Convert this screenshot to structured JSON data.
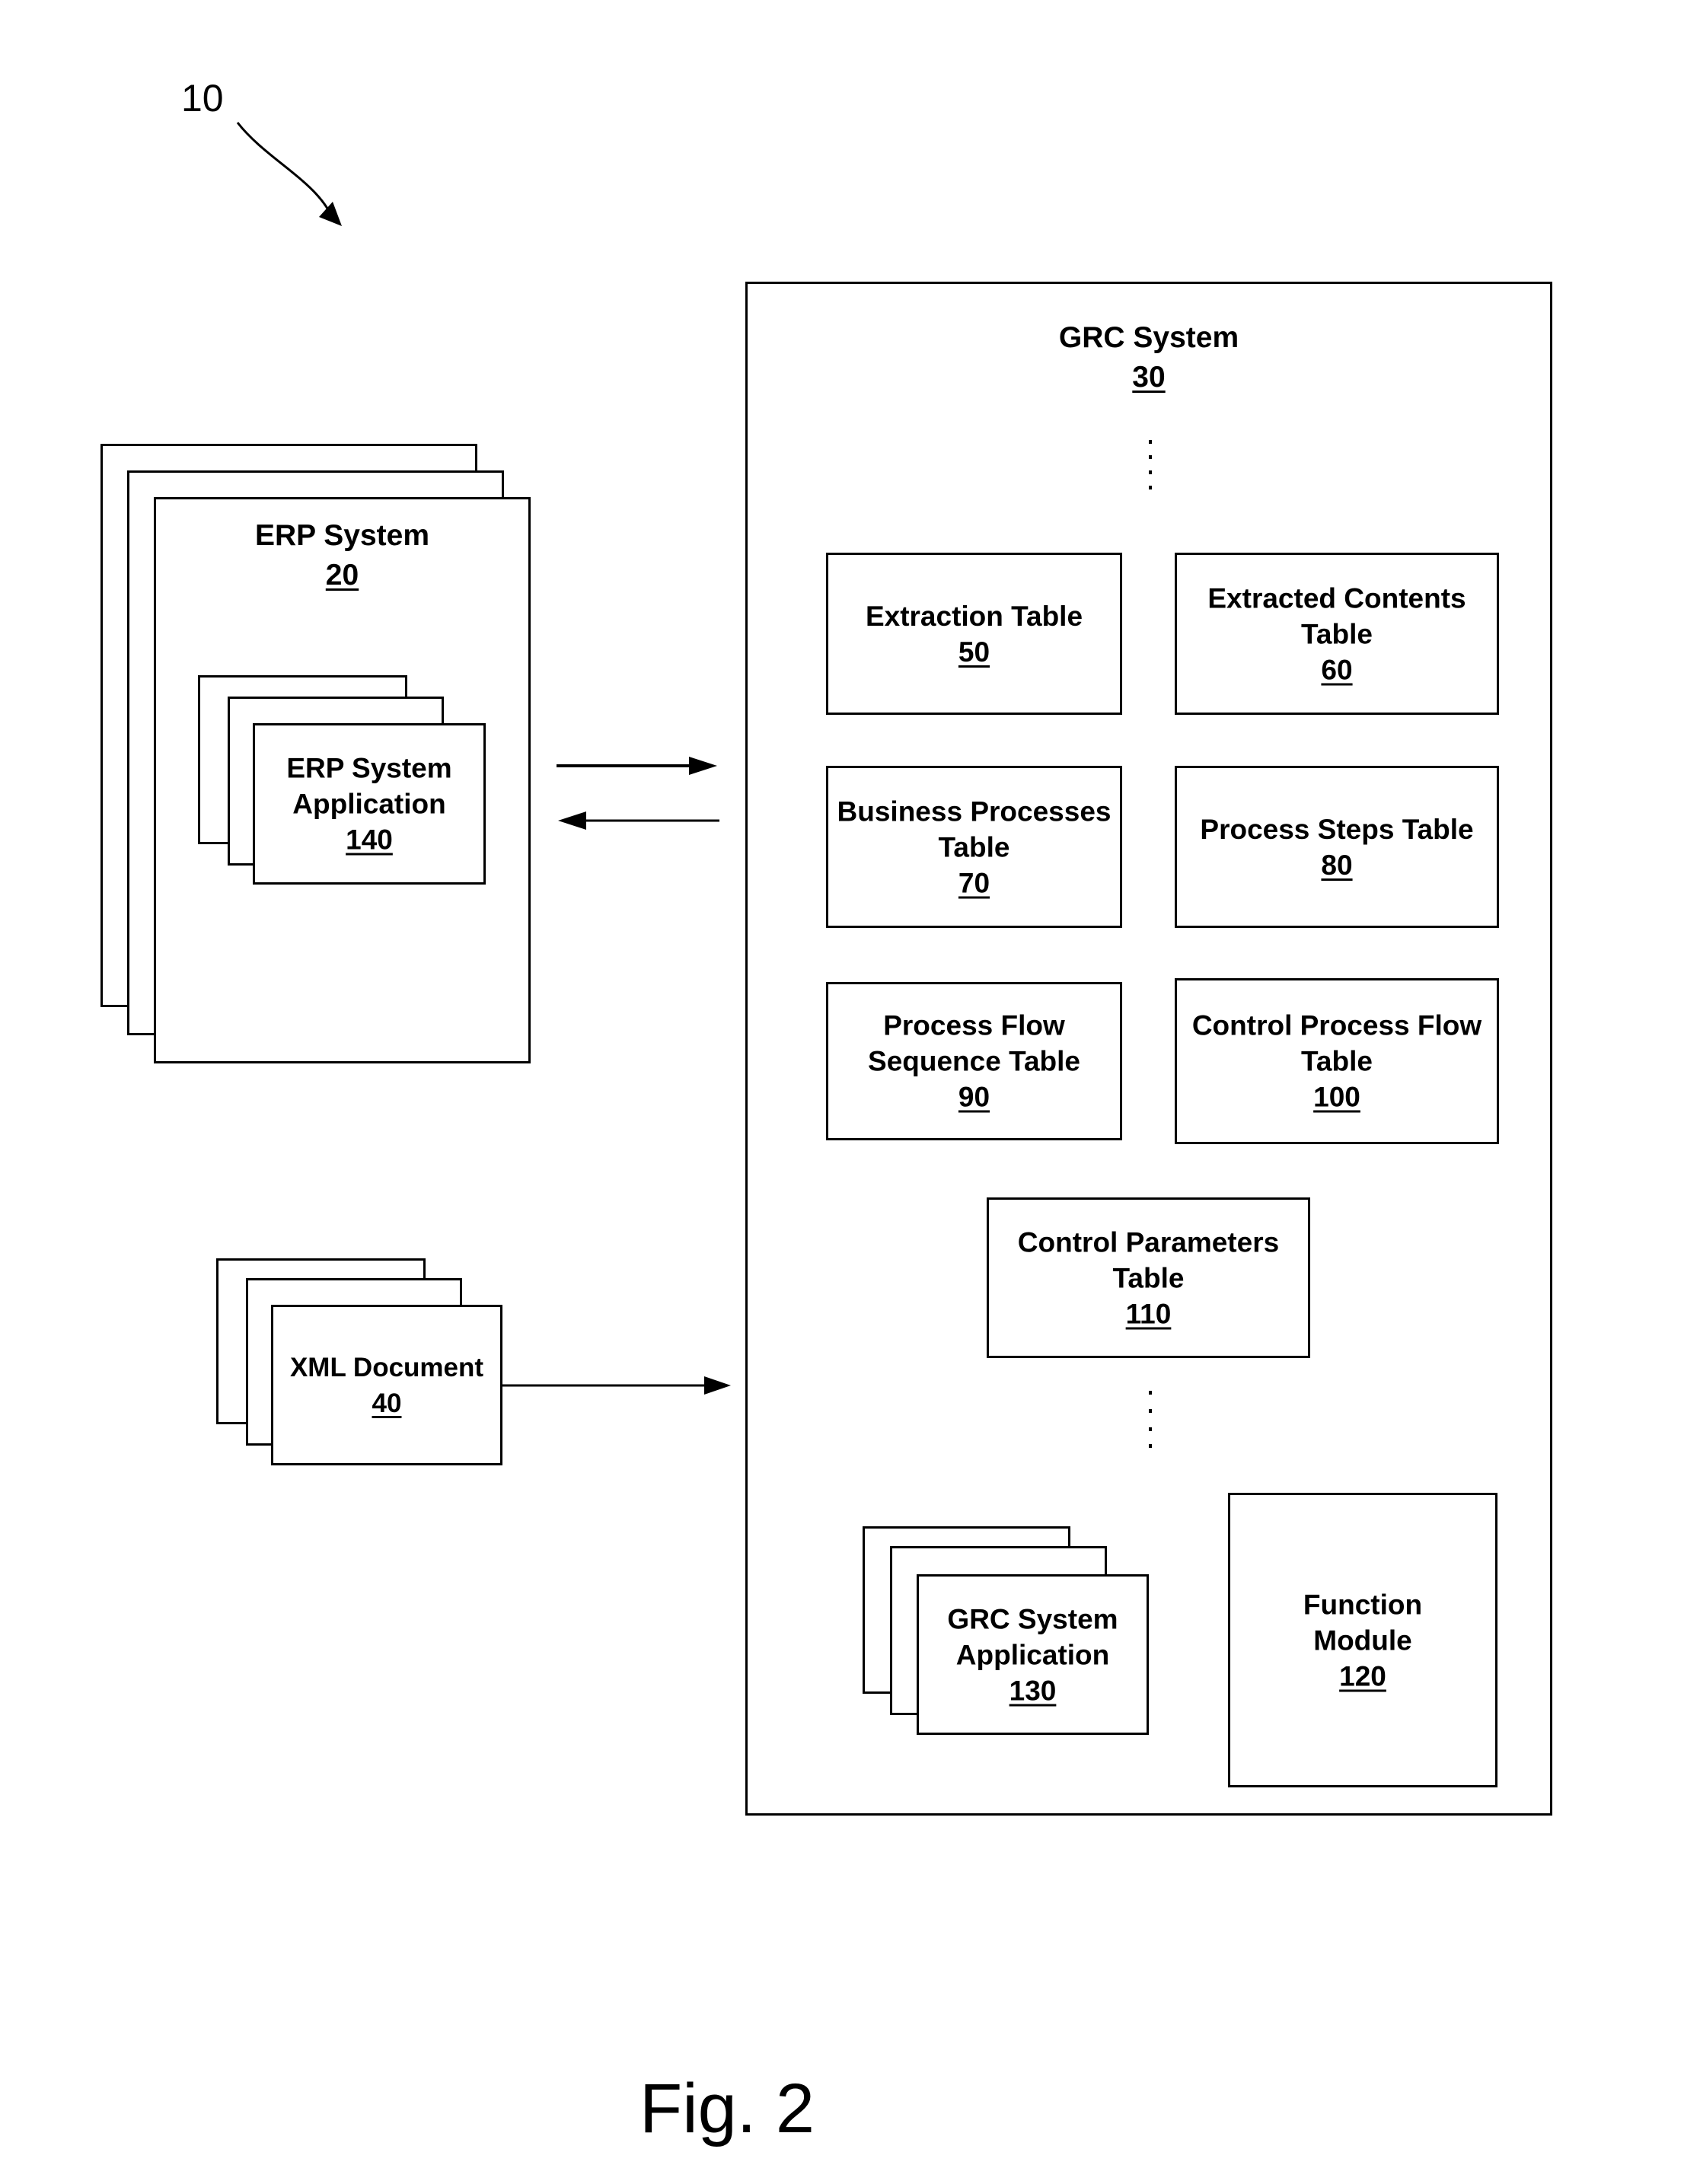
{
  "figure": {
    "reference_numeral": "10",
    "caption": "Fig. 2"
  },
  "erp_system": {
    "title": "ERP System",
    "number": "20",
    "application": {
      "title": "ERP System\nApplication",
      "number": "140"
    }
  },
  "xml_document": {
    "title": "XML Document",
    "number": "40"
  },
  "grc_system": {
    "title": "GRC System",
    "number": "30",
    "tables": [
      {
        "title": "Extraction Table",
        "number": "50"
      },
      {
        "title": "Extracted  Contents\nTable",
        "number": "60"
      },
      {
        "title": "Business Processes\nTable",
        "number": "70"
      },
      {
        "title": "Process Steps Table",
        "number": "80"
      },
      {
        "title": "Process Flow\nSequence Table",
        "number": "90"
      },
      {
        "title": "Control Process Flow\nTable",
        "number": "100"
      },
      {
        "title": "Control Parameters\nTable",
        "number": "110"
      }
    ],
    "function_module": {
      "title": "Function\nModule",
      "number": "120"
    },
    "application": {
      "title": "GRC System\nApplication",
      "number": "130"
    }
  },
  "connections": [
    {
      "from": "erp_system",
      "to": "grc_system",
      "direction": "right"
    },
    {
      "from": "grc_system",
      "to": "erp_system",
      "direction": "left"
    },
    {
      "from": "xml_document",
      "to": "grc_system",
      "direction": "right"
    }
  ]
}
